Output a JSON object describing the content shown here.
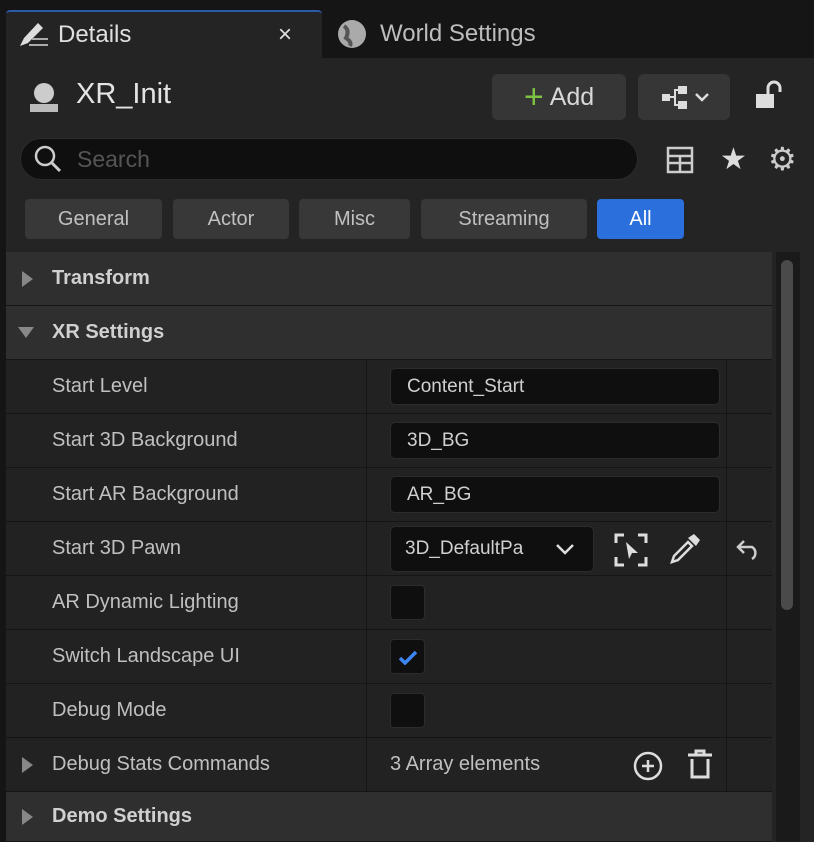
{
  "tabs": [
    {
      "label": "Details",
      "close": "×"
    },
    {
      "label": "World Settings"
    }
  ],
  "header": {
    "title": "XR_Init",
    "add_label": "Add"
  },
  "search": {
    "placeholder": "Search"
  },
  "filters": [
    {
      "label": "General"
    },
    {
      "label": "Actor"
    },
    {
      "label": "Misc"
    },
    {
      "label": "Streaming"
    },
    {
      "label": "All",
      "active": true
    }
  ],
  "categories": {
    "transform": "Transform",
    "xr": "XR Settings",
    "demo": "Demo Settings"
  },
  "properties": {
    "start_level": {
      "label": "Start Level",
      "value": "Content_Start"
    },
    "start_3d_bg": {
      "label": "Start 3D Background",
      "value": "3D_BG"
    },
    "start_ar_bg": {
      "label": "Start AR Background",
      "value": "AR_BG"
    },
    "start_3d_pawn": {
      "label": "Start 3D Pawn",
      "value": "3D_DefaultPa"
    },
    "ar_dynamic_lighting": {
      "label": "AR Dynamic Lighting",
      "checked": false
    },
    "switch_landscape_ui": {
      "label": "Switch Landscape UI",
      "checked": true
    },
    "debug_mode": {
      "label": "Debug Mode",
      "checked": false
    },
    "debug_stats": {
      "label": "Debug Stats Commands",
      "value": "3 Array elements"
    }
  },
  "colors": {
    "accent": "#2a6fdb",
    "add": "#7ec242"
  }
}
